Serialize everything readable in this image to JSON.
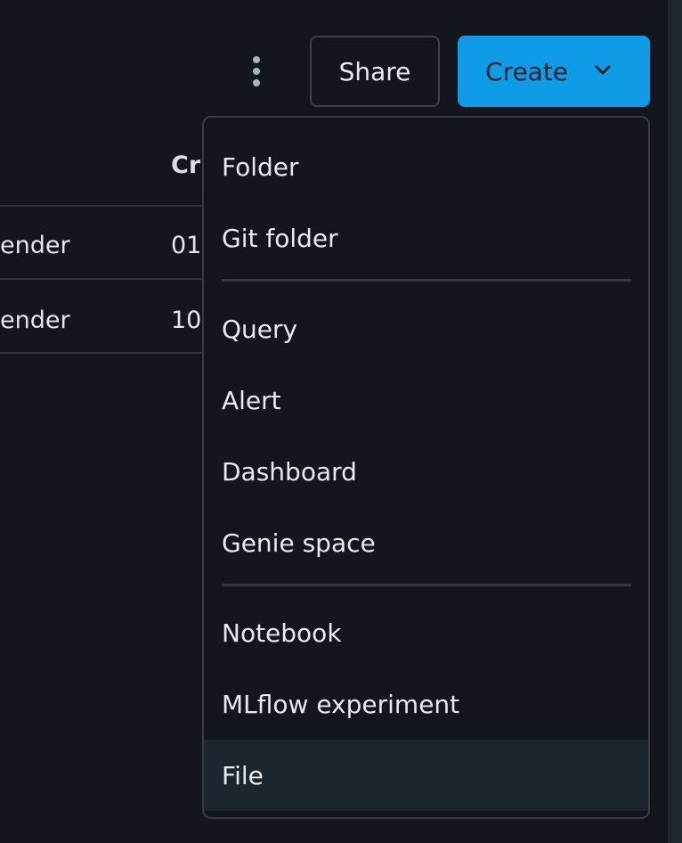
{
  "toolbar": {
    "more_icon": "kebab-vertical-icon",
    "share_label": "Share",
    "create_label": "Create",
    "create_icon": "chevron-down-icon"
  },
  "table": {
    "header_partial": "Cr",
    "rows": [
      {
        "owner_partial": "ender",
        "created_partial": "01"
      },
      {
        "owner_partial": "ender",
        "created_partial": "10"
      }
    ]
  },
  "create_menu": {
    "items": [
      {
        "label": "Folder"
      },
      {
        "label": "Git folder"
      },
      {
        "label": "Query"
      },
      {
        "label": "Alert"
      },
      {
        "label": "Dashboard"
      },
      {
        "label": "Genie space"
      },
      {
        "label": "Notebook"
      },
      {
        "label": "MLflow experiment"
      },
      {
        "label": "File"
      }
    ],
    "hovered": "File"
  },
  "colors": {
    "background": "#11171d",
    "primary": "#0f9be6",
    "menu_hover": "#1b252e"
  }
}
